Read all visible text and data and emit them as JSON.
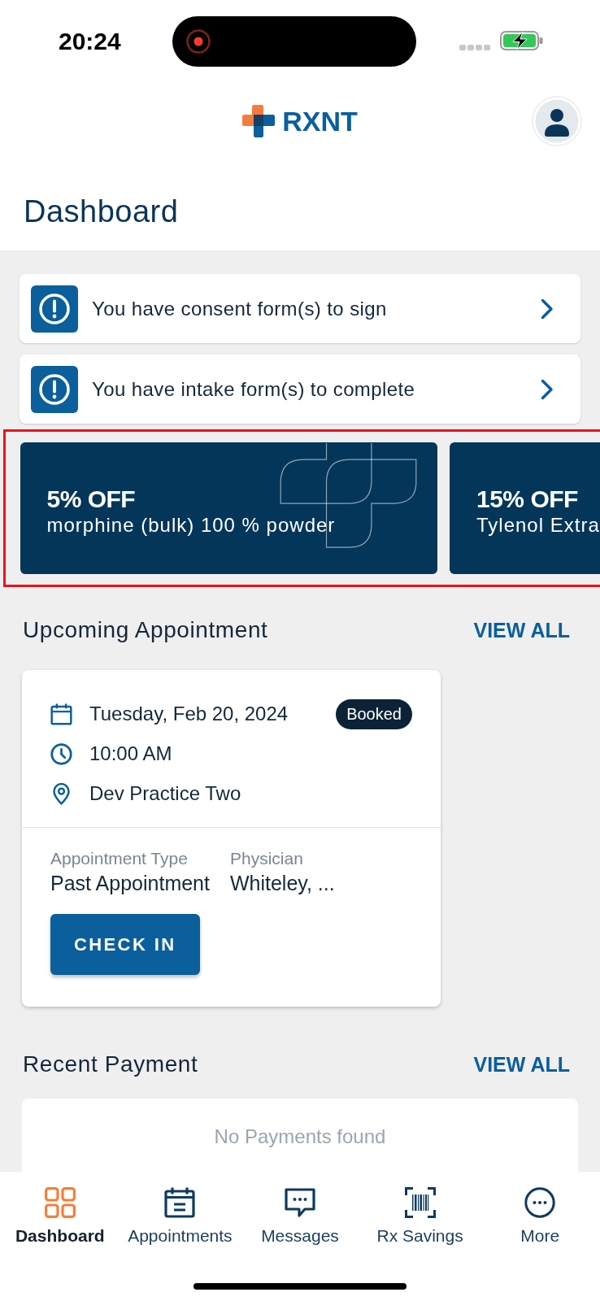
{
  "status_bar": {
    "time": "20:24",
    "recording": true,
    "charging": true
  },
  "header": {
    "logo_text": "RXNT"
  },
  "page_title": "Dashboard",
  "alerts": [
    {
      "text": "You have consent form(s) to sign"
    },
    {
      "text": "You have intake form(s) to complete"
    }
  ],
  "promos": {
    "highlighted": true,
    "items": [
      {
        "discount": "5% OFF",
        "product": "morphine (bulk) 100 % powder"
      },
      {
        "discount": "15% OFF",
        "product": "Tylenol Extra"
      }
    ]
  },
  "upcoming_appointment": {
    "title": "Upcoming Appointment",
    "view_all": "VIEW ALL",
    "date": "Tuesday, Feb 20, 2024",
    "status": "Booked",
    "time": "10:00 AM",
    "location": "Dev Practice Two",
    "details": [
      {
        "label": "Appointment Type",
        "value": "Past Appointment"
      },
      {
        "label": "Physician",
        "value": "Whiteley, ..."
      }
    ],
    "action": "CHECK IN"
  },
  "recent_payment": {
    "title": "Recent Payment",
    "view_all": "VIEW ALL",
    "empty_message": "No Payments found"
  },
  "bottom_nav": [
    {
      "kind": "grid",
      "label": "Dashboard",
      "selected": true
    },
    {
      "kind": "calendar",
      "label": "Appointments",
      "selected": false
    },
    {
      "kind": "chat",
      "label": "Messages",
      "selected": false
    },
    {
      "kind": "barcode",
      "label": "Rx Savings",
      "selected": false
    },
    {
      "kind": "more",
      "label": "More",
      "selected": false
    }
  ]
}
